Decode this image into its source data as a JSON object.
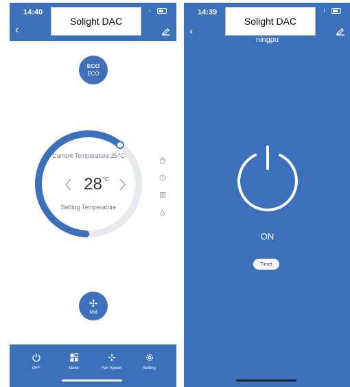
{
  "left_screen": {
    "status": {
      "time": "14:40"
    },
    "title": "Solight DAC",
    "eco": {
      "line1": "ECO",
      "line2": "ECO"
    },
    "current_temperature": "Current Temperature:25°C",
    "temperature_value": "28",
    "temperature_unit": "°C",
    "temperature_slider_fraction": 0.72,
    "setting_label": "Setting Temperature",
    "fan": {
      "label": "Mid",
      "icon": "fan-icon"
    },
    "side_icons": [
      "lock-icon",
      "clock-icon",
      "grid-icon",
      "drop-icon"
    ],
    "bottom_bar": [
      {
        "label": "OFF",
        "icon": "power-icon"
      },
      {
        "label": "Mode",
        "icon": "mode-icon"
      },
      {
        "label": "Fan Speed",
        "icon": "fan-icon"
      },
      {
        "label": "Setting",
        "icon": "gear-icon"
      }
    ]
  },
  "right_screen": {
    "status": {
      "time": "14:39"
    },
    "title": "Solight DAC",
    "subtitle": "ningpu",
    "state_label": "ON",
    "timer_label": "Timer"
  },
  "colors": {
    "accent": "#3d70ba",
    "track": "#e6e9ee",
    "text_muted": "#6e7a88",
    "white": "#ffffff"
  }
}
